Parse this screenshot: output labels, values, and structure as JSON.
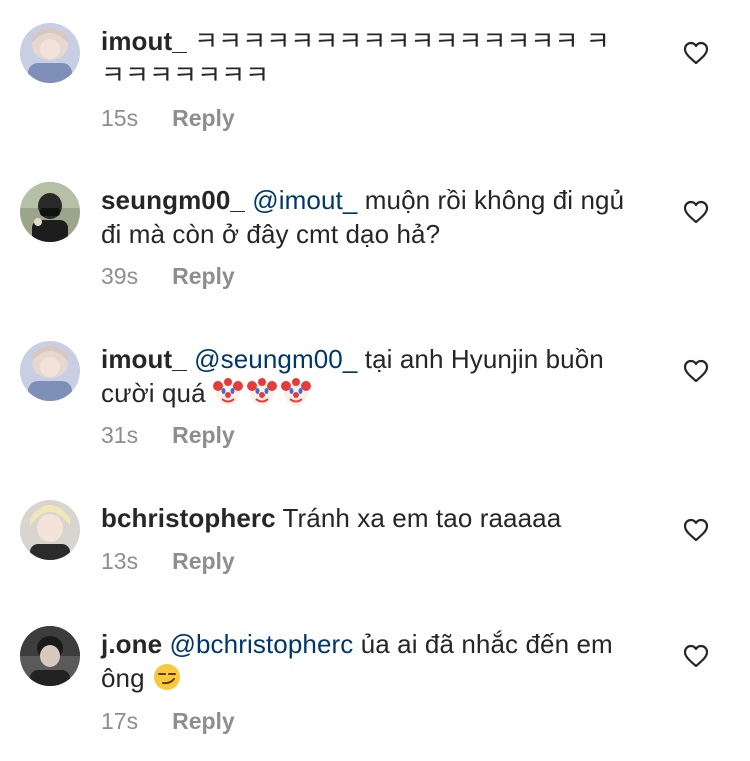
{
  "comments": [
    {
      "username": "imout_",
      "mention": "",
      "text": "ㅋㅋㅋㅋㅋㅋㅋㅋㅋㅋㅋㅋㅋㅋㅋㅋ ㅋㅋㅋㅋㅋㅋㅋㅋ",
      "time": "15s",
      "reply_label": "Reply"
    },
    {
      "username": "seungm00_",
      "mention": "@imout_",
      "text": "muộn rồi không đi ngủ đi mà còn ở đây cmt dạo hả?",
      "time": "39s",
      "reply_label": "Reply"
    },
    {
      "username": "imout_",
      "mention": "@seungm00_",
      "text": "tại anh Hyunjin buồn cười quá",
      "emojis": [
        "clown-face",
        "clown-face",
        "clown-face"
      ],
      "time": "31s",
      "reply_label": "Reply"
    },
    {
      "username": "bchristopherc",
      "mention": "",
      "text": "Tránh xa em tao raaaaa",
      "time": "13s",
      "reply_label": "Reply"
    },
    {
      "username": "j.one",
      "mention": "@bchristopherc",
      "text": "ủa ai đã nhắc đến em ông",
      "emojis": [
        "smirking-face"
      ],
      "time": "17s",
      "reply_label": "Reply"
    }
  ],
  "colors": {
    "text": "#262626",
    "mention": "#00376b",
    "meta": "#8e8e8e",
    "background": "#ffffff"
  },
  "icons": {
    "like": "heart-outline-icon"
  }
}
